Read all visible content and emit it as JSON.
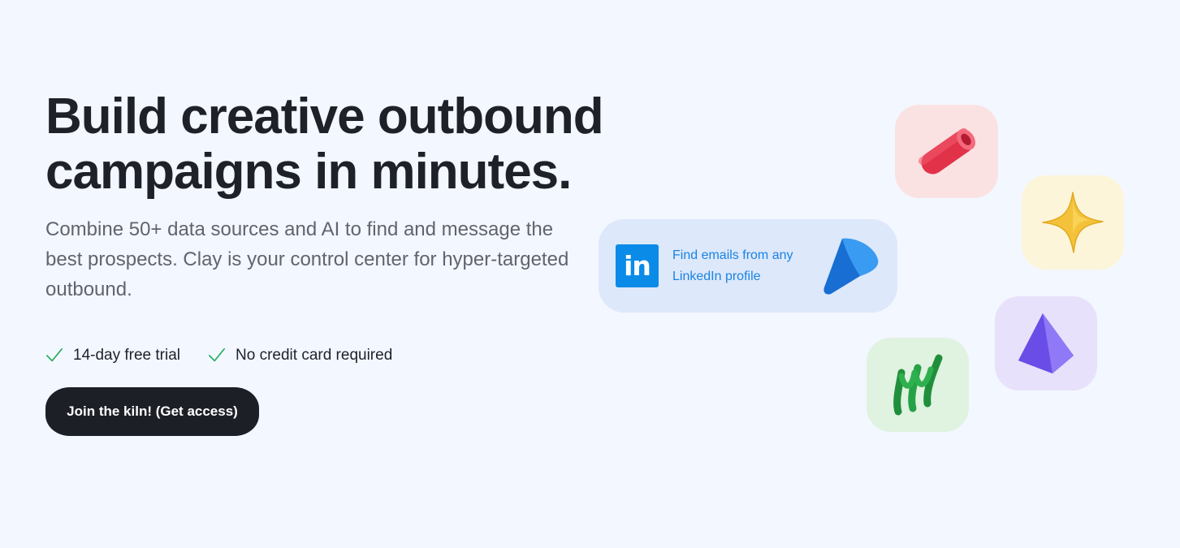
{
  "hero": {
    "headline_line1": "Build creative outbound",
    "headline_line2": "campaigns in minutes.",
    "subhead": "Combine 50+ data sources and AI to find and message the best prospects. Clay is your control center for hyper-targeted outbound.",
    "perks": [
      {
        "label": "14-day free trial",
        "icon": "check-icon"
      },
      {
        "label": "No credit card required",
        "icon": "check-icon"
      }
    ],
    "cta_label": "Join the kiln! (Get access)"
  },
  "visual": {
    "linkedin_card": {
      "logo_text": "in",
      "text": "Find emails from any LinkedIn profile"
    },
    "tiles": [
      {
        "name": "red-tube-icon",
        "color": "#fbe2e2"
      },
      {
        "name": "yellow-star-icon",
        "color": "#fdf5da"
      },
      {
        "name": "purple-pyramid-icon",
        "color": "#e8e1fb"
      },
      {
        "name": "green-squiggle-icon",
        "color": "#e0f2e0"
      }
    ]
  },
  "colors": {
    "background": "#f3f7ff",
    "cta_background": "#1d1f26",
    "check": "#1fae5b",
    "linkedin_blue": "#0a8be8"
  }
}
